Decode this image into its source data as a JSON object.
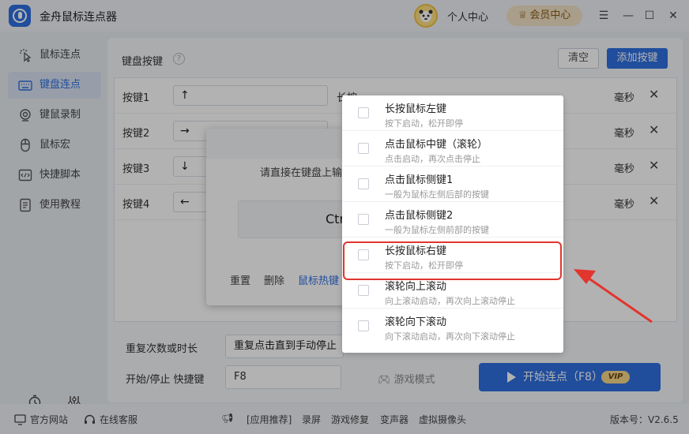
{
  "app": {
    "title": "金舟鼠标连点器"
  },
  "header": {
    "user_center": "个人中心",
    "vip_center": "会员中心",
    "window_controls": {
      "menu": "☰",
      "minimize": "—",
      "maximize": "☐",
      "close": "✕"
    }
  },
  "sidebar": {
    "items": [
      {
        "label": "鼠标连点",
        "icon": "mouse-click-icon",
        "active": false
      },
      {
        "label": "键盘连点",
        "icon": "keyboard-icon",
        "active": true
      },
      {
        "label": "键鼠录制",
        "icon": "record-icon",
        "active": false
      },
      {
        "label": "鼠标宏",
        "icon": "mouse-icon",
        "active": false
      },
      {
        "label": "快捷脚本",
        "icon": "script-icon",
        "active": false
      },
      {
        "label": "使用教程",
        "icon": "tutorial-icon",
        "active": false
      }
    ],
    "bottom": [
      {
        "label": "定时",
        "icon": "timer-icon"
      },
      {
        "label": "设置",
        "icon": "settings-icon"
      }
    ]
  },
  "main": {
    "section_title": "键盘按键",
    "clear_label": "清空",
    "add_label": "添加按键",
    "rows": [
      {
        "label": "按键1",
        "key": "↑",
        "long_press": "长按",
        "ms": "毫秒"
      },
      {
        "label": "按键2",
        "key": "→",
        "ms": "毫秒"
      },
      {
        "label": "按键3",
        "key": "↓",
        "ms": "毫秒"
      },
      {
        "label": "按键4",
        "key": "←",
        "ms": "毫秒"
      }
    ],
    "repeat_label": "重复次数或时长",
    "repeat_value": "重复点击直到手动停止",
    "hotkey_label": "开始/停止 快捷键",
    "hotkey_value": "F8",
    "game_mode": "游戏模式",
    "start_label": "开始连点（F8）",
    "vip_tag": "VIP"
  },
  "dialog": {
    "tip": "请直接在键盘上输",
    "key_value": "Ctr",
    "reset": "重置",
    "delete": "删除",
    "mouse_hotkey": "鼠标热键"
  },
  "menu": {
    "items": [
      {
        "title": "长按鼠标左键",
        "desc": "按下启动，松开即停"
      },
      {
        "title": "点击鼠标中键（滚轮）",
        "desc": "点击启动，再次点击停止"
      },
      {
        "title": "点击鼠标侧键1",
        "desc": "一般为鼠标左侧后部的按键"
      },
      {
        "title": "点击鼠标侧键2",
        "desc": "一般为鼠标左侧前部的按键"
      },
      {
        "title": "长按鼠标右键",
        "desc": "按下启动，松开即停"
      },
      {
        "title": "滚轮向上滚动",
        "desc": "向上滚动启动，再次向上滚动停止"
      },
      {
        "title": "滚轮向下滚动",
        "desc": "向下滚动启动，再次向下滚动停止"
      }
    ]
  },
  "footer": {
    "website": "官方网站",
    "support": "在线客服",
    "recommend": "[应用推荐]",
    "links": [
      "录屏",
      "游戏修复",
      "变声器",
      "虚拟摄像头"
    ],
    "version": "版本号：V2.6.5"
  },
  "colors": {
    "accent": "#2f6fe0",
    "highlight": "#e2352e"
  }
}
